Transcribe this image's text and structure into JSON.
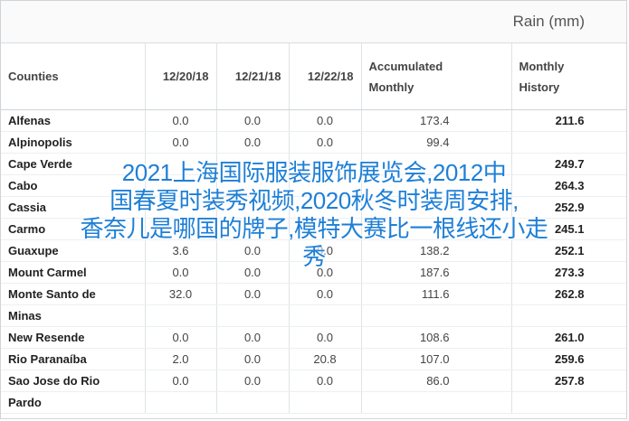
{
  "table": {
    "caption": "Rain (mm)",
    "headers": {
      "counties": "Counties",
      "d1": "12/20/18",
      "d2": "12/21/18",
      "d3": "12/22/18",
      "acc_line1": "Accumulated",
      "acc_line2": "Monthly",
      "hist_line1": "Monthly",
      "hist_line2": "History"
    },
    "rows": [
      {
        "name": "Alfenas",
        "d1": "0.0",
        "d2": "0.0",
        "d3": "0.0",
        "acc": "173.4",
        "hist": "211.6"
      },
      {
        "name": "Alpinopolis",
        "d1": "0.0",
        "d2": "0.0",
        "d3": "0.0",
        "acc": "99.4",
        "hist": ""
      },
      {
        "name": "Cape Verde",
        "d1": "",
        "d2": "",
        "d3": "",
        "acc": "",
        "hist": "249.7"
      },
      {
        "name": "Cabo",
        "d1": "",
        "d2": "",
        "d3": "",
        "acc": "",
        "hist": "264.3"
      },
      {
        "name": "Cassia",
        "d1": "",
        "d2": "",
        "d3": "",
        "acc": "",
        "hist": "252.9"
      },
      {
        "name": "Carmo",
        "d1": "",
        "d2": "",
        "d3": "",
        "acc": "",
        "hist": "245.1"
      },
      {
        "name": "Guaxupe",
        "d1": "3.6",
        "d2": "0.0",
        "d3": "0.0",
        "acc": "138.2",
        "hist": "252.1"
      },
      {
        "name": "Mount Carmel",
        "d1": "0.0",
        "d2": "0.0",
        "d3": "0.0",
        "acc": "187.6",
        "hist": "273.3"
      },
      {
        "name": "Monte Santo de",
        "d1": "32.0",
        "d2": "0.0",
        "d3": "0.0",
        "acc": "111.6",
        "hist": "262.8"
      },
      {
        "name": "Minas",
        "d1": "",
        "d2": "",
        "d3": "",
        "acc": "",
        "hist": ""
      },
      {
        "name": "New Resende",
        "d1": "0.0",
        "d2": "0.0",
        "d3": "0.0",
        "acc": "108.6",
        "hist": "261.0"
      },
      {
        "name": "Rio Paranaíba",
        "d1": "2.0",
        "d2": "0.0",
        "d3": "20.8",
        "acc": "107.0",
        "hist": "259.6"
      },
      {
        "name": "Sao Jose do Rio",
        "d1": "0.0",
        "d2": "0.0",
        "d3": "0.0",
        "acc": "86.0",
        "hist": "257.8"
      },
      {
        "name": "Pardo",
        "d1": "",
        "d2": "",
        "d3": "",
        "acc": "",
        "hist": ""
      }
    ]
  },
  "overlay": {
    "line1": "2021上海国际服装服饰展览会,2012中",
    "line2": "国春夏时装秀视频,2020秋冬时装周安排,",
    "line3": "香奈儿是哪国的牌子,模特大赛比一根线还小走",
    "line4": "秀"
  }
}
